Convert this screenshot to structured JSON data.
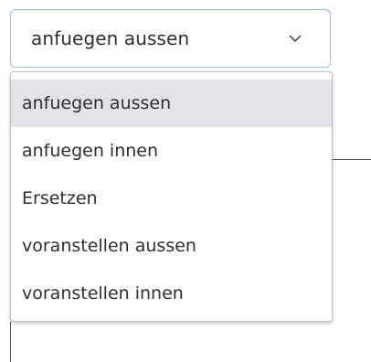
{
  "select": {
    "value": "anfuegen aussen",
    "icon": "chevron-down-icon"
  },
  "menu": {
    "options": [
      {
        "label": "anfuegen aussen",
        "selected": true
      },
      {
        "label": "anfuegen innen",
        "selected": false
      },
      {
        "label": "Ersetzen",
        "selected": false
      },
      {
        "label": "voranstellen aussen",
        "selected": false
      },
      {
        "label": "voranstellen innen",
        "selected": false
      }
    ]
  },
  "colors": {
    "select_border": "#8ec3e6",
    "selected_option_bg": "#e3e2e8",
    "text": "#2e2e2e"
  }
}
